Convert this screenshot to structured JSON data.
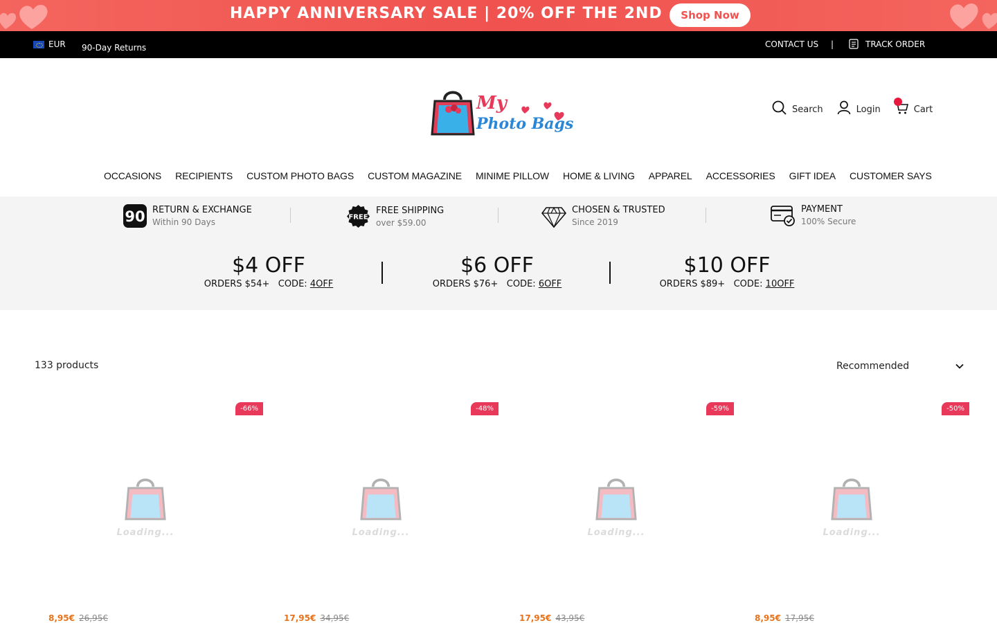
{
  "promo": {
    "text": "HAPPY ANNIVERSARY SALE  |  20% OFF THE 2ND",
    "button": "Shop Now"
  },
  "topbar": {
    "currency": "EUR",
    "returns": "90-Day Returns",
    "contact": "CONTACT US",
    "separator": "|",
    "track": "TRACK ORDER"
  },
  "logo": {
    "line1": "My",
    "line2": "Photo Bags"
  },
  "header_actions": {
    "search": "Search",
    "login": "Login",
    "cart": "Cart"
  },
  "nav": [
    "OCCASIONS",
    "RECIPIENTS",
    "CUSTOM PHOTO BAGS",
    "CUSTOM MAGAZINE",
    "MINIME PILLOW",
    "HOME & LIVING",
    "APPAREL",
    "ACCESSORIES",
    "GIFT IDEA",
    "CUSTOMER SAYS"
  ],
  "features": [
    {
      "title": "RETURN & EXCHANGE",
      "sub": "Within 90 Days",
      "icon": "90-days-icon"
    },
    {
      "title": "FREE SHIPPING",
      "sub": "over $59.00",
      "icon": "free-badge-icon"
    },
    {
      "title": "CHOSEN & TRUSTED",
      "sub": "Since 2019",
      "icon": "diamond-icon"
    },
    {
      "title": "PAYMENT",
      "sub": "100% Secure",
      "icon": "secure-card-icon"
    }
  ],
  "coupons": [
    {
      "amount": "$4 OFF",
      "orders": "ORDERS $54+",
      "code_label": "CODE:",
      "code": "4OFF"
    },
    {
      "amount": "$6 OFF",
      "orders": "ORDERS $76+",
      "code_label": "CODE:",
      "code": "6OFF"
    },
    {
      "amount": "$10 OFF",
      "orders": "ORDERS $89+",
      "code_label": "CODE:",
      "code": "10OFF"
    }
  ],
  "listing": {
    "count": "133 products",
    "sort": "Recommended"
  },
  "products": [
    {
      "badge": "-66%",
      "loading": "Loading...",
      "price": "8,95€",
      "compare": "26,95€"
    },
    {
      "badge": "-48%",
      "loading": "Loading...",
      "price": "17,95€",
      "compare": "34,95€"
    },
    {
      "badge": "-59%",
      "loading": "Loading...",
      "price": "17,95€",
      "compare": "43,95€"
    },
    {
      "badge": "-50%",
      "loading": "Loading...",
      "price": "8,95€",
      "compare": "17,95€"
    }
  ],
  "colors": {
    "promo": "#f0524f",
    "accent": "#e8395a",
    "price": "#e8731b"
  }
}
